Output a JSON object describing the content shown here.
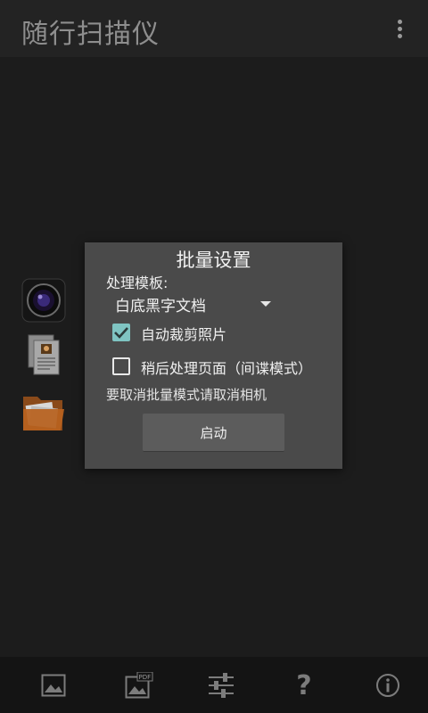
{
  "header": {
    "title": "随行扫描仪"
  },
  "side_icons": [
    "camera-icon",
    "documents-icon",
    "folder-icon"
  ],
  "dialog": {
    "title": "批量设置",
    "template_label": "处理模板:",
    "template_value": "白底黑字文档",
    "auto_crop_label": "自动裁剪照片",
    "auto_crop_checked": true,
    "process_later_label": "稍后处理页面（间谍模式）",
    "process_later_checked": false,
    "hint": "要取消批量模式请取消相机",
    "start_label": "启动"
  },
  "bottom_bar": {
    "icons": [
      "gallery-icon",
      "pdf-icon",
      "settings-sliders-icon",
      "help-icon",
      "info-icon"
    ],
    "help_glyph": "?"
  },
  "colors": {
    "background": "#1c1c1c",
    "dialog": "#4a4a4a",
    "checkbox_accent": "#7fc4c2",
    "bottom_bar": "#141414"
  }
}
